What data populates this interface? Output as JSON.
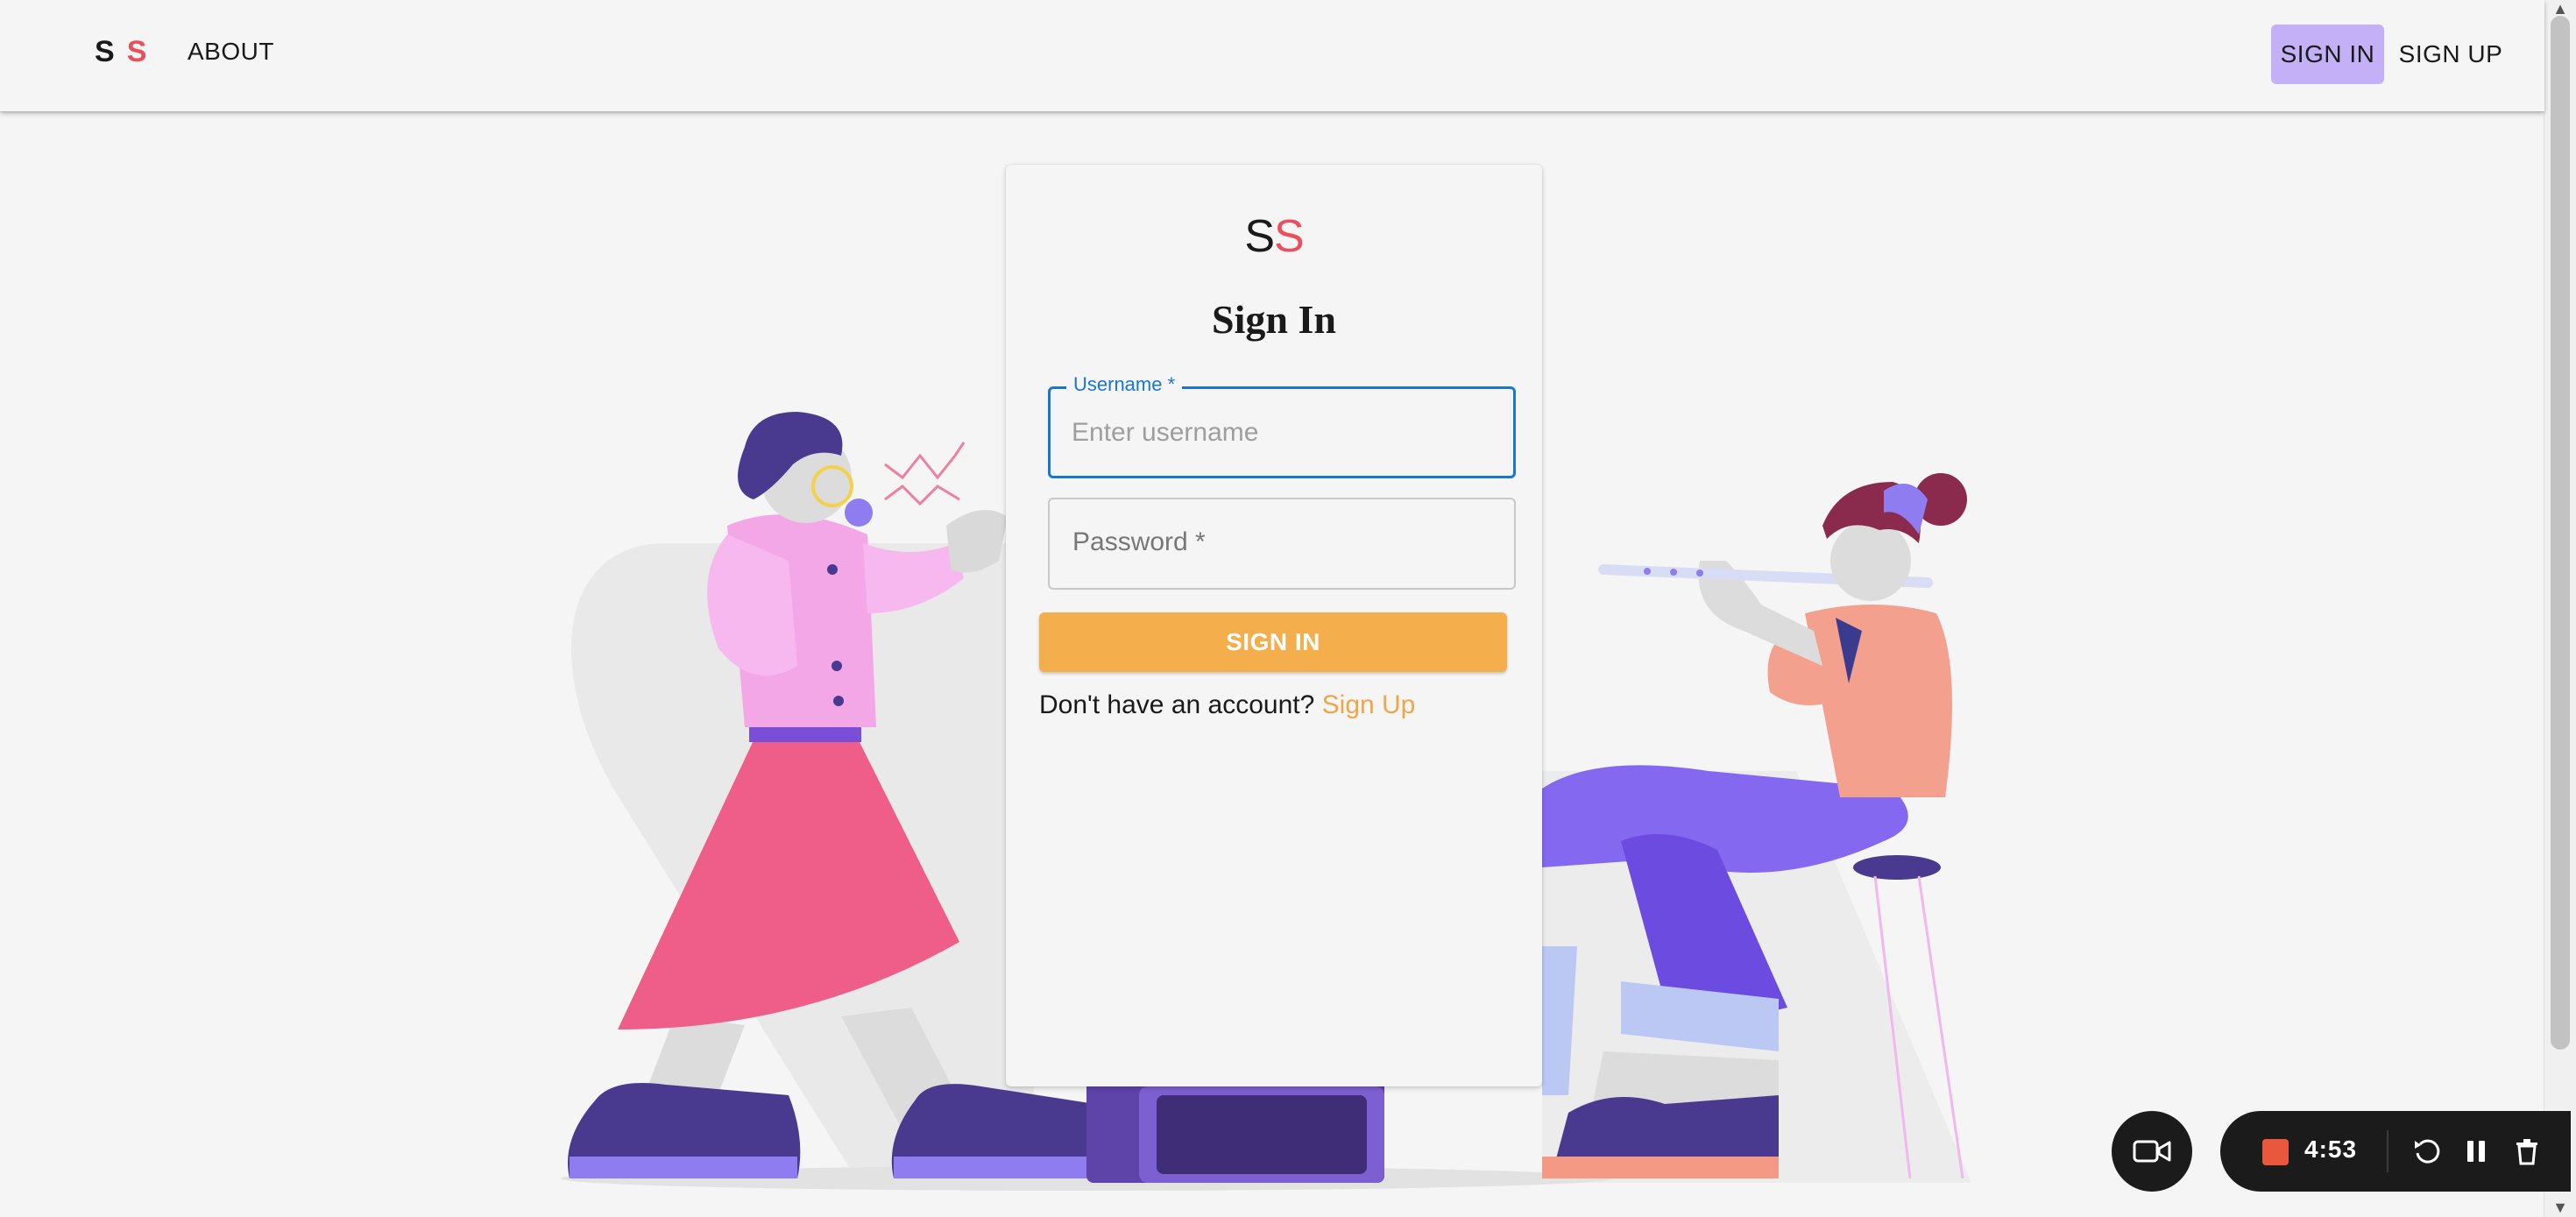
{
  "navbar": {
    "logo_left": "S",
    "logo_right": "S",
    "about": "ABOUT",
    "sign_in": "SIGN IN",
    "sign_up": "SIGN UP"
  },
  "card": {
    "logo_left": "S",
    "logo_right": "S",
    "title": "Sign In",
    "username_label": "Username *",
    "username_placeholder": "Enter username",
    "password_label": "Password *",
    "submit": "SIGN IN",
    "prompt": "Don't have an account?",
    "signup_link": "Sign Up"
  },
  "recorder": {
    "elapsed": "4:53",
    "icons": [
      "camera-icon",
      "stop-icon",
      "restart-icon",
      "pause-icon",
      "delete-icon"
    ]
  },
  "colors": {
    "accent_orange": "#f4af4c",
    "brand_red": "#ea4f5e",
    "nav_active": "#c4b0f7",
    "focus_blue": "#1976d2"
  }
}
